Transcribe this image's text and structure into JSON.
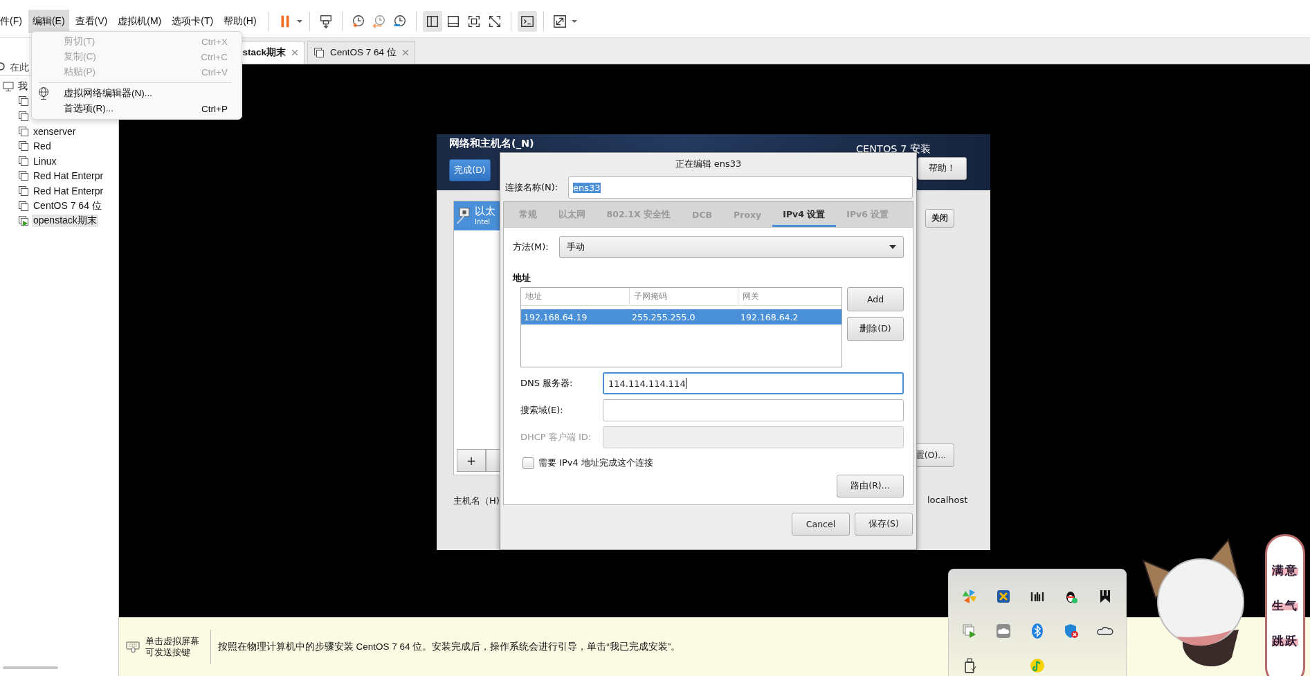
{
  "menu_bar": [
    {
      "label": "件(F)",
      "selected": false
    },
    {
      "label": "编辑(E)",
      "selected": true
    },
    {
      "label": "查看(V)",
      "selected": false
    },
    {
      "label": "虚拟机(M)",
      "selected": false
    },
    {
      "label": "选项卡(T)",
      "selected": false
    },
    {
      "label": "帮助(H)",
      "selected": false
    }
  ],
  "edit_menu": [
    {
      "kind": "item",
      "label": "剪切(T)",
      "shortcut": "Ctrl+X",
      "disabled": true
    },
    {
      "kind": "item",
      "label": "复制(C)",
      "shortcut": "Ctrl+C",
      "disabled": true
    },
    {
      "kind": "item",
      "label": "粘贴(P)",
      "shortcut": "Ctrl+V",
      "disabled": true
    },
    {
      "kind": "separator"
    },
    {
      "kind": "network-item",
      "label": "虚拟网络编辑器(N)...",
      "disabled": false
    },
    {
      "kind": "item",
      "label": "首选项(R)...",
      "shortcut": "Ctrl+P",
      "disabled": false
    }
  ],
  "library": {
    "search": {
      "placeholder": "在此"
    },
    "tree": [
      {
        "label": "我",
        "children": [
          {
            "selected": false,
            "running": false
          },
          {
            "selected": false,
            "running": false
          },
          {
            "label": "xenserver",
            "selected": false,
            "running": false
          },
          {
            "label": "Red",
            "selected": false,
            "running": false
          },
          {
            "label": "Linux",
            "selected": false,
            "running": false
          },
          {
            "label": "Red Hat Enterpr",
            "selected": false,
            "running": false
          },
          {
            "label": "Red Hat Enterpr",
            "selected": false,
            "running": false
          },
          {
            "label": "CentOS 7 64 位",
            "selected": false,
            "running": false
          },
          {
            "label": "openstack期末",
            "selected": true,
            "running": true
          }
        ]
      }
    ]
  },
  "vm_tabs": [
    {
      "label": "stack期末",
      "selected": true
    },
    {
      "label": "CentOS 7 64 位",
      "selected": false
    }
  ],
  "installer": {
    "header_title": "网络和主机名(_N)",
    "product": "CENTOS 7 安装",
    "done_button": "完成(D)",
    "help_button": "帮助！",
    "device": {
      "name": "以太",
      "subtitle": "Intel",
      "selected": true
    },
    "off_button": "关闭",
    "configure_button": "置(O)...",
    "add_button": "+",
    "hostname_label": "主机名（H)",
    "hostname": "localhost"
  },
  "editor": {
    "title": "正在编辑 ens33",
    "name_label": "连接名称(N):",
    "name_value": "ens33",
    "name_selected": true,
    "tabs": [
      {
        "label": "常规",
        "selected": false
      },
      {
        "label": "以太网",
        "selected": false
      },
      {
        "label": "802.1X 安全性",
        "selected": false
      },
      {
        "label": "DCB",
        "selected": false
      },
      {
        "label": "Proxy",
        "selected": false
      },
      {
        "label": "IPv4 设置",
        "selected": true
      },
      {
        "label": "IPv6 设置",
        "selected": false
      }
    ],
    "method_label": "方法(M):",
    "method_value": "手动",
    "section": "地址",
    "table": {
      "columns": [
        "地址",
        "子网掩码",
        "网关"
      ],
      "rows": [
        {
          "cells": [
            "192.168.64.19",
            "255.255.255.0",
            "192.168.64.2"
          ],
          "selected": true
        }
      ]
    },
    "add_button": "Add",
    "delete_button": "删除(D)",
    "fields": [
      {
        "label": "DNS 服务器:",
        "value": "114.114.114.114",
        "focused": true,
        "disabled": false
      },
      {
        "label": "搜索域(E):",
        "focused": false,
        "disabled": false
      },
      {
        "label": "DHCP 客户端 ID:",
        "focused": false,
        "disabled": true
      }
    ],
    "require_checkbox": {
      "label": "需要 IPv4 地址完成这个连接",
      "checked": false
    },
    "routes_button": "路由(R)...",
    "cancel_button": "Cancel",
    "save_button": "保存(S)"
  },
  "hint_bar": {
    "click_hint": "单击虚拟屏幕可发送按键",
    "message": "按照在物理计算机中的步骤安装 CentOS 7 64 位。安装完成后，操作系统会进行引导，单击“我已完成安装”。"
  },
  "pet_menu": [
    {
      "label": "满意"
    },
    {
      "label": "生气"
    },
    {
      "label": "跳跃"
    }
  ]
}
